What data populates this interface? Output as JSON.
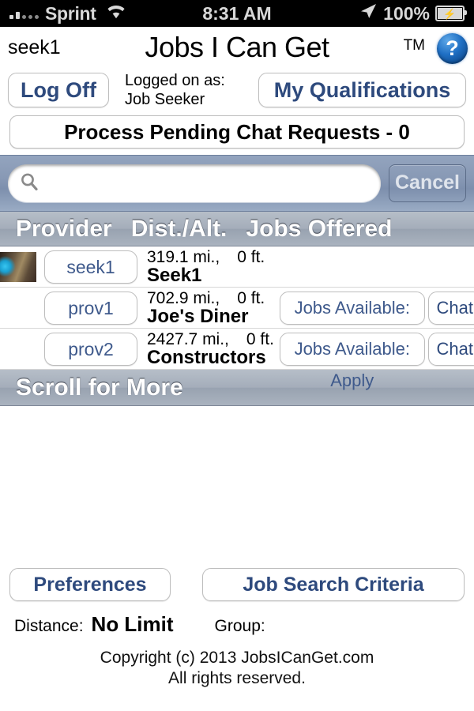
{
  "status_bar": {
    "carrier": "Sprint",
    "time": "8:31 AM",
    "battery_percent": "100%",
    "wifi_icon": "wifi-icon",
    "location_icon": "location-arrow-icon",
    "battery_icon": "battery-charging-icon",
    "signal_icon": "signal-bars-icon"
  },
  "title_bar": {
    "user_tag": "seek1",
    "app_title": "Jobs I Can Get",
    "trademark": "TM",
    "help_icon_label": "?"
  },
  "actions": {
    "log_off_label": "Log Off",
    "logged_on_line1": "Logged on as:",
    "logged_on_line2": "Job Seeker",
    "my_qualifications_label": "My Qualifications",
    "chat_requests_label": "Process Pending Chat Requests - 0"
  },
  "search": {
    "value": "",
    "placeholder": "",
    "cancel_label": "Cancel",
    "search_icon": "search-icon"
  },
  "table": {
    "headers": [
      "Provider",
      "Dist./Alt.",
      "Jobs Offered"
    ],
    "rows": [
      {
        "has_thumbnail": true,
        "provider_id": "seek1",
        "distance": "319.1 mi.,",
        "altitude": "0 ft.",
        "name": "Seek1",
        "apply_label": "",
        "chat_label": ""
      },
      {
        "has_thumbnail": false,
        "provider_id": "prov1",
        "distance": "702.9 mi.,",
        "altitude": "0 ft.",
        "name": "Joe's Diner",
        "apply_label": "Jobs Available: Apply",
        "chat_label": "Chat"
      },
      {
        "has_thumbnail": false,
        "provider_id": "prov2",
        "distance": "2427.7 mi.,",
        "altitude": "0 ft.",
        "name": "Constructors",
        "apply_label": "Jobs Available: Apply",
        "chat_label": "Chat"
      }
    ],
    "scroll_more_label": "Scroll for More"
  },
  "footer": {
    "preferences_label": "Preferences",
    "job_search_criteria_label": "Job Search Criteria",
    "distance_label": "Distance:",
    "distance_value": "No Limit",
    "group_label": "Group:",
    "group_value": "",
    "copyright_line1": "Copyright (c) 2013 JobsICanGet.com",
    "copyright_line2": "All rights reserved."
  },
  "colors": {
    "accent_blue": "#2e4a7d",
    "link_blue": "#3f5a8c",
    "search_bar_bg": "#8899b5",
    "header_bar_bg": "#a4adba",
    "help_icon_blue": "#1f6fc4"
  }
}
